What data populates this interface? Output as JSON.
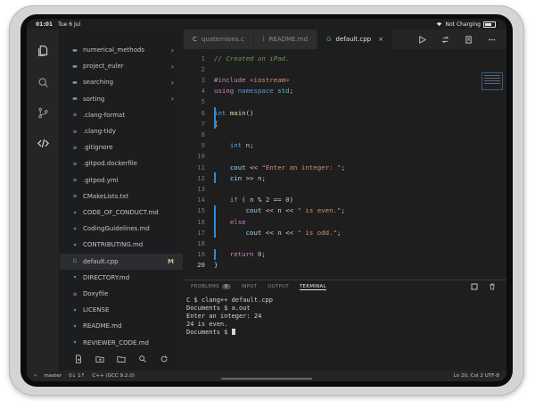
{
  "status_bar": {
    "time": "01:01",
    "date": "Tue 6 Jul",
    "charging": "Not Charging"
  },
  "activity_bar": {
    "icons": [
      "explorer-icon",
      "search-icon",
      "source-control-icon",
      "code-icon",
      "menu-icon"
    ]
  },
  "explorer": {
    "items": [
      {
        "label": "numerical_methods",
        "type": "folder"
      },
      {
        "label": "project_euler",
        "type": "folder"
      },
      {
        "label": "searching",
        "type": "folder"
      },
      {
        "label": "sorting",
        "type": "folder"
      },
      {
        "label": ".clang-format",
        "type": "file"
      },
      {
        "label": ".clang-tidy",
        "type": "file"
      },
      {
        "label": ".gitignore",
        "type": "file"
      },
      {
        "label": ".gitpod.dockerfile",
        "type": "file"
      },
      {
        "label": ".gitpod.yml",
        "type": "file"
      },
      {
        "label": "CMakeLists.txt",
        "type": "file"
      },
      {
        "label": "CODE_OF_CONDUCT.md",
        "type": "md"
      },
      {
        "label": "CodingGuidelines.md",
        "type": "md"
      },
      {
        "label": "CONTRIBUTING.md",
        "type": "md"
      },
      {
        "label": "default.cpp",
        "type": "cpp",
        "active": true,
        "mark": "M"
      },
      {
        "label": "DIRECTORY.md",
        "type": "md"
      },
      {
        "label": "Doxyfile",
        "type": "file"
      },
      {
        "label": "LICENSE",
        "type": "md"
      },
      {
        "label": "README.md",
        "type": "md"
      },
      {
        "label": "REVIEWER_CODE.md",
        "type": "md"
      }
    ]
  },
  "tabs": [
    {
      "label": "quaternions.c",
      "icon": "C",
      "active": false
    },
    {
      "label": "README.md",
      "icon": "i",
      "active": false
    },
    {
      "label": "default.cpp",
      "icon": "G",
      "active": true
    }
  ],
  "editor": {
    "lines": [
      {
        "n": "1",
        "html": "<span class='c-comment'>// Created on iPad.</span>"
      },
      {
        "n": "2",
        "html": ""
      },
      {
        "n": "3",
        "html": "<span class='c-pre'>#include</span> <span class='c-str'>&lt;iostream&gt;</span>"
      },
      {
        "n": "4",
        "html": "<span class='c-kw'>using</span> <span class='c-type'>namespace</span> <span class='c-ns'>std</span>;"
      },
      {
        "n": "5",
        "html": ""
      },
      {
        "n": "6",
        "html": "<span class='c-type'>int</span> <span class='c-fn'>main</span>()"
      },
      {
        "n": "7",
        "html": "{"
      },
      {
        "n": "8",
        "html": ""
      },
      {
        "n": "9",
        "html": "    <span class='c-type'>int</span> <span class='c-var'>n</span>;"
      },
      {
        "n": "10",
        "html": ""
      },
      {
        "n": "11",
        "html": "    <span class='c-var'>cout</span> &lt;&lt; <span class='c-str'>\"Enter an integer: \"</span>;"
      },
      {
        "n": "12",
        "html": "    <span class='c-var'>cin</span> &gt;&gt; <span class='c-var'>n</span>;"
      },
      {
        "n": "13",
        "html": ""
      },
      {
        "n": "14",
        "html": "    <span class='c-kw'>if</span> ( <span class='c-var'>n</span> % <span class='c-num'>2</span> == <span class='c-num'>0</span>)"
      },
      {
        "n": "15",
        "html": "        <span class='c-var'>cout</span> &lt;&lt; <span class='c-var'>n</span> &lt;&lt; <span class='c-str'>\" is even.\"</span>;"
      },
      {
        "n": "16",
        "html": "    <span class='c-kw'>else</span>"
      },
      {
        "n": "17",
        "html": "        <span class='c-var'>cout</span> &lt;&lt; <span class='c-var'>n</span> &lt;&lt; <span class='c-str'>\" is odd.\"</span>;"
      },
      {
        "n": "18",
        "html": ""
      },
      {
        "n": "19",
        "html": "    <span class='c-kw'>return</span> <span class='c-num'>0</span>;"
      },
      {
        "n": "20",
        "html": "}"
      }
    ],
    "current_line": "20"
  },
  "panel": {
    "tabs": [
      "PROBLEMS",
      "INPUT",
      "OUTPUT",
      "TERMINAL"
    ],
    "problems_count": "0",
    "active_tab": "TERMINAL",
    "terminal_lines": [
      "C $ clang++ default.cpp",
      "Documents $ a.out",
      "Enter an integer: 24",
      "24 is even.",
      "Documents $ "
    ]
  },
  "statusline": {
    "branch": "master",
    "sync": "0↓ 1↑",
    "compiler": "C++ (GCC 9.2.0)",
    "position": "Ln 20, Col 2",
    "encoding": "UTF-8"
  }
}
